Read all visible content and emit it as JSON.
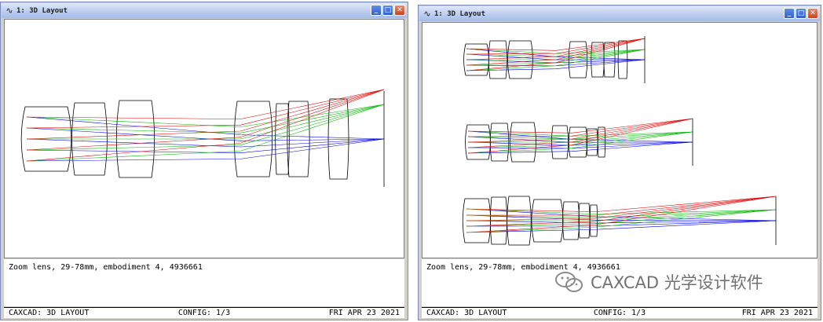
{
  "windows": [
    {
      "title": "1: 3D Layout",
      "description": "Zoom lens, 29-78mm, embodiment 4, 4936661",
      "status": {
        "left": "CAXCAD: 3D LAYOUT",
        "center": "CONFIG: 1/3",
        "right": "FRI APR 23 2021"
      },
      "buttons": {
        "minimize": "_",
        "maximize": "□",
        "close": "✕"
      }
    },
    {
      "title": "1: 3D Layout",
      "description": "Zoom lens, 29-78mm, embodiment 4, 4936661",
      "status": {
        "left": "CAXCAD: 3D LAYOUT",
        "center": "CONFIG: 1/3",
        "right": "FRI APR 23 2021"
      },
      "buttons": {
        "minimize": "_",
        "maximize": "□",
        "close": "✕"
      }
    }
  ],
  "watermark": {
    "text": "CAXCAD 光学设计软件",
    "icon": "wechat-icon"
  },
  "colors": {
    "field_1": "#0000e0",
    "field_2": "#00b800",
    "field_3": "#e00000"
  }
}
